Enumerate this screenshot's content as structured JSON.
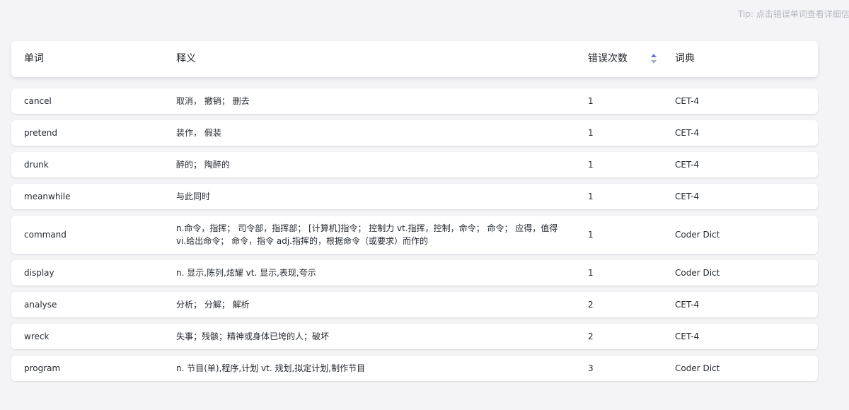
{
  "tip": "Tip: 点击错误单词查看详细信息",
  "header": {
    "word": "单词",
    "translation": "释义",
    "count": "错误次数",
    "dict": "词典"
  },
  "sort_icon": "sort-caret-icon",
  "colors": {
    "sort_active": "#6b74d4",
    "sort_inactive": "#a9adb8",
    "background": "#f4f4f7"
  },
  "rows": [
    {
      "word": "cancel",
      "translation": "取消， 撤销； 删去",
      "count": "1",
      "dict": "CET-4"
    },
    {
      "word": "pretend",
      "translation": "装作， 假装",
      "count": "1",
      "dict": "CET-4"
    },
    {
      "word": "drunk",
      "translation": "醉的； 陶醉的",
      "count": "1",
      "dict": "CET-4"
    },
    {
      "word": "meanwhile",
      "translation": "与此同时",
      "count": "1",
      "dict": "CET-4"
    },
    {
      "word": "command",
      "translation": "n.命令，指挥； 司令部，指挥部； [计算机]指令； 控制力 vt.指挥，控制，命令； 命令； 应得，值得 vi.给出命令； 命令，指令 adj.指挥的，根据命令（或要求）而作的",
      "count": "1",
      "dict": "Coder Dict"
    },
    {
      "word": "display",
      "translation": "n. 显示,陈列,炫耀 vt. 显示,表现,夸示",
      "count": "1",
      "dict": "Coder Dict"
    },
    {
      "word": "analyse",
      "translation": "分析； 分解； 解析",
      "count": "2",
      "dict": "CET-4"
    },
    {
      "word": "wreck",
      "translation": "失事；残骸；精神或身体已垮的人；破坏",
      "count": "2",
      "dict": "CET-4"
    },
    {
      "word": "program",
      "translation": "n. 节目(单),程序,计划 vt. 规划,拟定计划,制作节目",
      "count": "3",
      "dict": "Coder Dict"
    }
  ]
}
